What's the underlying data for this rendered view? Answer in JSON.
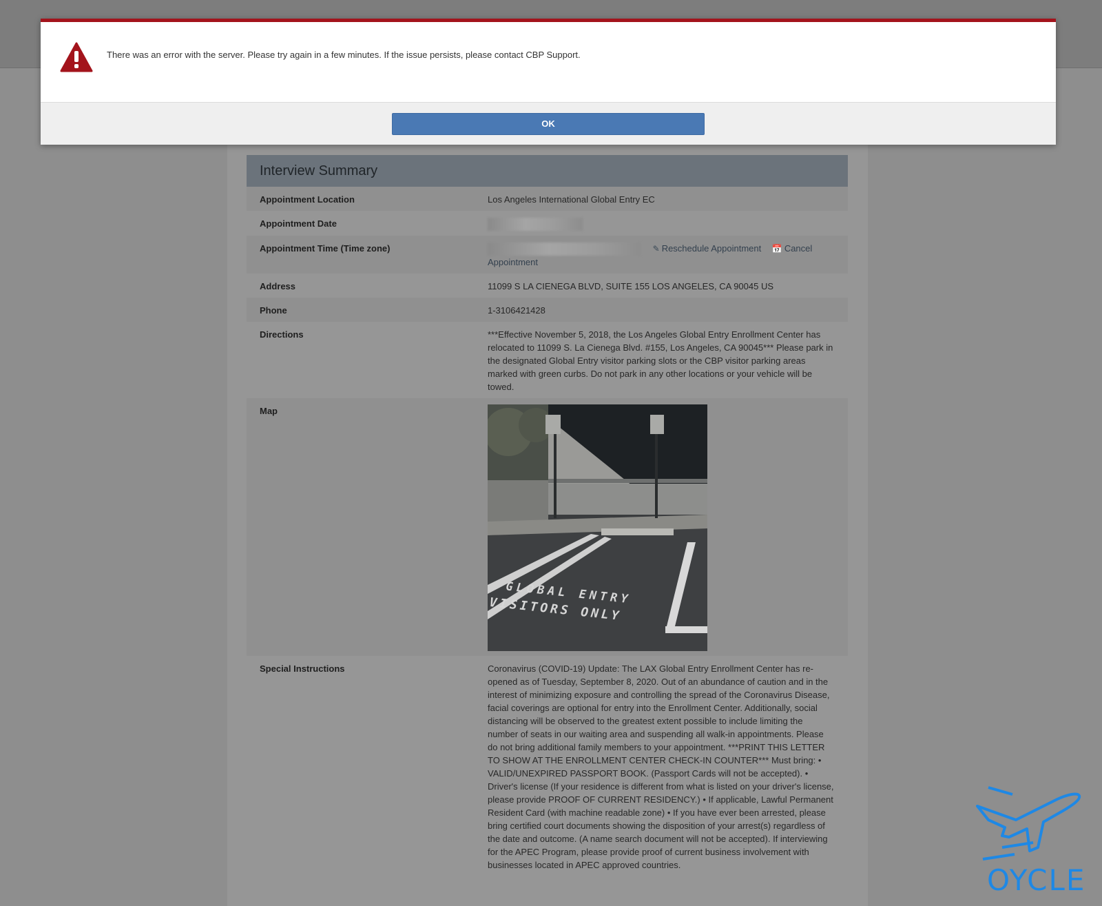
{
  "modal": {
    "message": "There was an error with the server. Please try again in a few minutes. If the issue persists, please contact CBP Support.",
    "ok_label": "OK",
    "accent_color": "#a3141c",
    "icon": "warning-triangle-icon"
  },
  "summary": {
    "title": "Interview Summary",
    "location_label": "Appointment Location",
    "location_value": "Los Angeles International Global Entry EC",
    "date_label": "Appointment Date",
    "time_label": "Appointment Time (Time zone)",
    "reschedule_label": "Reschedule Appointment",
    "cancel_label": "Cancel",
    "cancel_label_cont": "Appointment",
    "address_label": "Address",
    "address_value": "11099 S LA CIENEGA BLVD, SUITE 155 LOS ANGELES, CA 90045 US",
    "phone_label": "Phone",
    "phone_value": "1-3106421428",
    "directions_label": "Directions",
    "directions_value": "***Effective November 5, 2018, the Los Angeles Global Entry Enrollment Center has relocated to 11099 S. La Cienega Blvd. #155, Los Angeles, CA 90045*** Please park in the designated Global Entry visitor parking slots or the CBP visitor parking areas marked with green curbs. Do not park in any other locations or your vehicle will be towed.",
    "map_label": "Map",
    "map_photo_text_1": "GLOBAL ENTRY",
    "map_photo_text_2": "VISITORS ONLY",
    "special_label": "Special Instructions",
    "special_value": "Coronavirus (COVID-19) Update: The LAX Global Entry Enrollment Center has re-opened as of Tuesday, September 8, 2020. Out of an abundance of caution and in the interest of minimizing exposure and controlling the spread of the Coronavirus Disease, facial coverings are optional for entry into the Enrollment Center. Additionally, social distancing will be observed to the greatest extent possible to include limiting the number of seats in our waiting area and suspending all walk-in appointments. Please do not bring additional family members to your appointment. ***PRINT THIS LETTER TO SHOW AT THE ENROLLMENT CENTER CHECK-IN COUNTER*** Must bring: • VALID/UNEXPIRED PASSPORT BOOK. (Passport Cards will not be accepted). • Driver's license (If your residence is different from what is listed on your driver's license, please provide PROOF OF CURRENT RESIDENCY.) • If applicable, Lawful Permanent Resident Card (with machine readable zone) • If you have ever been arrested, please bring certified court documents showing the disposition of your arrest(s) regardless of the date and outcome. (A name search document will not be accepted). If interviewing for the APEC Program, please provide proof of current business involvement with businesses located in APEC approved countries."
  },
  "watermark": {
    "text": "OYCLE",
    "color": "#1e88e5"
  }
}
